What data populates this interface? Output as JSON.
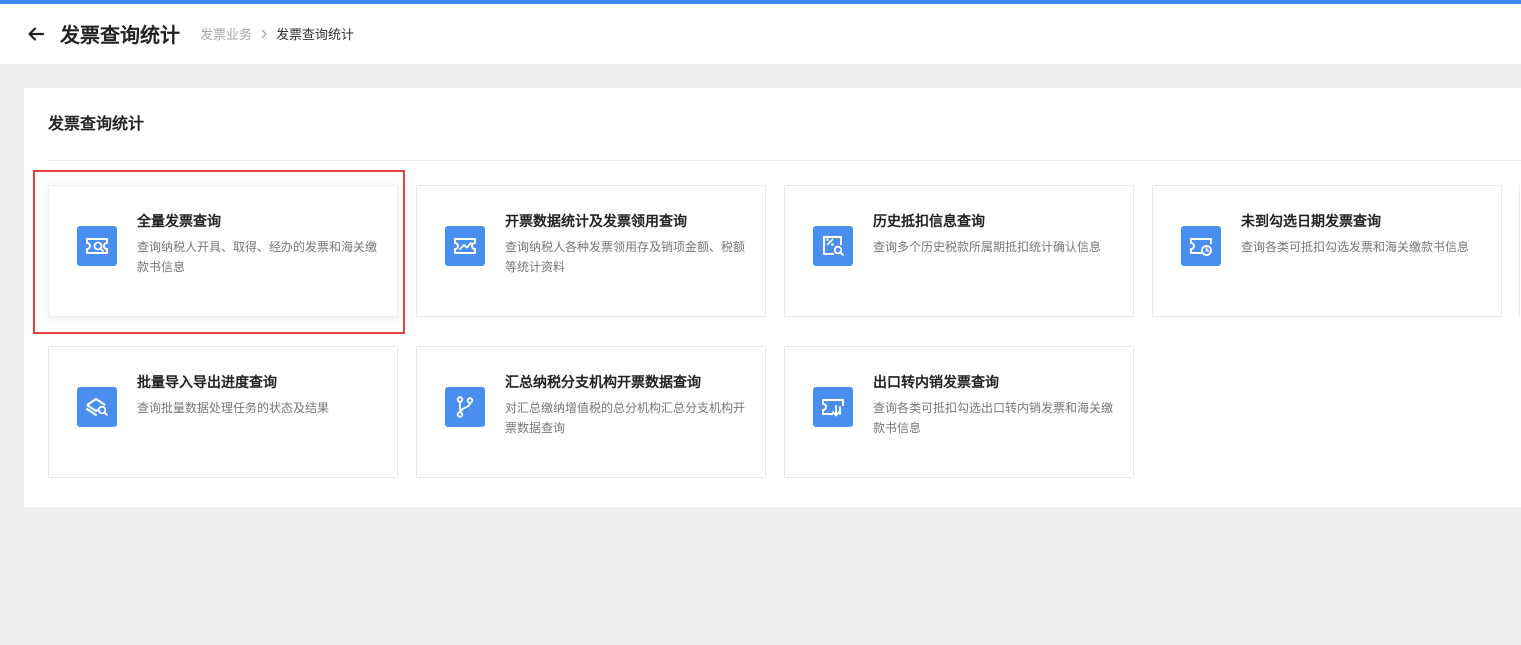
{
  "header": {
    "back_icon": "arrow-left-icon",
    "title": "发票查询统计",
    "breadcrumb": {
      "parent": "发票业务",
      "separator_icon": "chevron-right-icon",
      "current": "发票查询统计"
    }
  },
  "panel": {
    "title": "发票查询统计"
  },
  "cards": [
    {
      "title": "全量发票查询",
      "desc": "查询纳税人开具、取得、经办的发票和海关缴款书信息",
      "icon": "invoice-search-icon",
      "selected": true
    },
    {
      "title": "开票数据统计及发票领用查询",
      "desc": "查询纳税人各种发票领用存及销项金额、税额等统计资料",
      "icon": "invoice-chart-icon",
      "selected": false
    },
    {
      "title": "历史抵扣信息查询",
      "desc": "查询多个历史税款所属期抵扣统计确认信息",
      "icon": "tax-percent-search-icon",
      "selected": false
    },
    {
      "title": "未到勾选日期发票查询",
      "desc": "查询各类可抵扣勾选发票和海关缴款书信息",
      "icon": "invoice-clock-icon",
      "selected": false
    },
    {
      "title": "批量导入导出进度查询",
      "desc": "查询批量数据处理任务的状态及结果",
      "icon": "batch-progress-search-icon",
      "selected": false
    },
    {
      "title": "汇总纳税分支机构开票数据查询",
      "desc": "对汇总缴纳增值税的总分机构汇总分支机构开票数据查询",
      "icon": "branch-icon",
      "selected": false
    },
    {
      "title": "出口转内销发票查询",
      "desc": "查询各类可抵扣勾选出口转内销发票和海关缴款书信息",
      "icon": "invoice-return-icon",
      "selected": false
    }
  ],
  "colors": {
    "accent": "#3d86f4",
    "icon_bg": "#4a8ff0",
    "selection_outline": "#e8413e"
  }
}
